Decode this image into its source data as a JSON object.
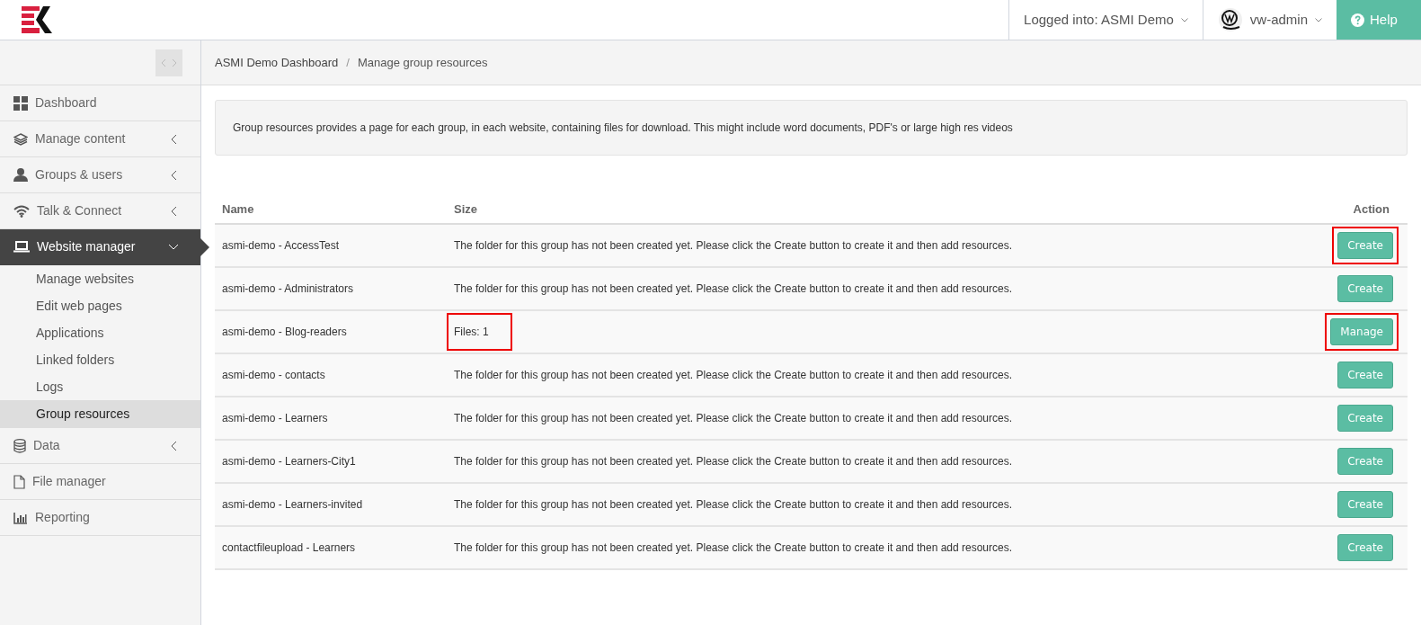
{
  "header": {
    "logged_into": "Logged into: ASMI Demo",
    "user": "vw-admin",
    "help": "Help"
  },
  "sidebar": {
    "items": [
      {
        "label": "Dashboard",
        "kind": "link",
        "selected": false
      },
      {
        "label": "Manage content",
        "kind": "menu",
        "expanded": false,
        "selected": false
      },
      {
        "label": "Groups & users",
        "kind": "menu",
        "expanded": false,
        "selected": false
      },
      {
        "label": "Talk & Connect",
        "kind": "menu",
        "expanded": false,
        "selected": false
      },
      {
        "label": "Website manager",
        "kind": "menu",
        "expanded": true,
        "selected": true,
        "children": [
          {
            "label": "Manage websites",
            "selected": false
          },
          {
            "label": "Edit web pages",
            "selected": false
          },
          {
            "label": "Applications",
            "selected": false
          },
          {
            "label": "Linked folders",
            "selected": false
          },
          {
            "label": "Logs",
            "selected": false
          },
          {
            "label": "Group resources",
            "selected": true
          }
        ]
      },
      {
        "label": "Data",
        "kind": "menu",
        "expanded": false,
        "selected": false
      },
      {
        "label": "File manager",
        "kind": "link",
        "selected": false
      },
      {
        "label": "Reporting",
        "kind": "link",
        "selected": false
      }
    ]
  },
  "breadcrumb": {
    "items": [
      "ASMI Demo Dashboard",
      "Manage group resources"
    ],
    "separator": "/"
  },
  "info": "Group resources provides a page for each group, in each website, containing files for download. This might include word documents, PDF's or large high res videos",
  "table": {
    "columns": [
      "Name",
      "Size",
      "Action"
    ],
    "rows": [
      {
        "name": "asmi-demo - AccessTest",
        "size": "The folder for this group has not been created yet. Please click the Create button to create it and then add resources.",
        "action": "Create",
        "size_highlighted": false,
        "action_highlighted": true
      },
      {
        "name": "asmi-demo - Administrators",
        "size": "The folder for this group has not been created yet. Please click the Create button to create it and then add resources.",
        "action": "Create",
        "size_highlighted": false,
        "action_highlighted": false
      },
      {
        "name": "asmi-demo - Blog-readers",
        "size": "Files: 1",
        "action": "Manage",
        "size_highlighted": true,
        "action_highlighted": true
      },
      {
        "name": "asmi-demo - contacts",
        "size": "The folder for this group has not been created yet. Please click the Create button to create it and then add resources.",
        "action": "Create",
        "size_highlighted": false,
        "action_highlighted": false
      },
      {
        "name": "asmi-demo - Learners",
        "size": "The folder for this group has not been created yet. Please click the Create button to create it and then add resources.",
        "action": "Create",
        "size_highlighted": false,
        "action_highlighted": false
      },
      {
        "name": "asmi-demo - Learners-City1",
        "size": "The folder for this group has not been created yet. Please click the Create button to create it and then add resources.",
        "action": "Create",
        "size_highlighted": false,
        "action_highlighted": false
      },
      {
        "name": "asmi-demo - Learners-invited",
        "size": "The folder for this group has not been created yet. Please click the Create button to create it and then add resources.",
        "action": "Create",
        "size_highlighted": false,
        "action_highlighted": false
      },
      {
        "name": "contactfileupload - Learners",
        "size": "The folder for this group has not been created yet. Please click the Create button to create it and then add resources.",
        "action": "Create",
        "size_highlighted": false,
        "action_highlighted": false
      }
    ]
  }
}
